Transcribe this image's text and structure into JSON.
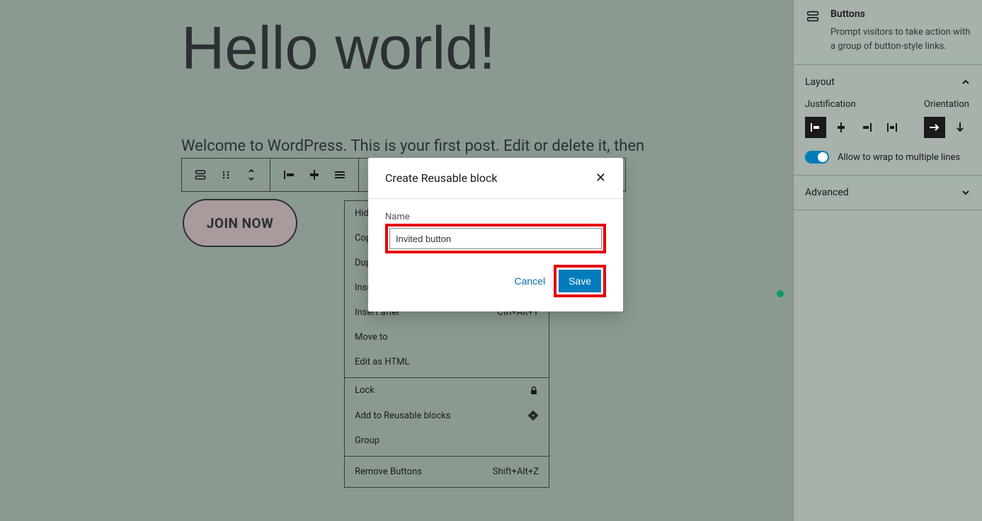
{
  "post": {
    "title": "Hello world!",
    "body": "Welcome to WordPress. This is your first post. Edit or delete it, then",
    "button_label": "JOIN NOW"
  },
  "context_menu": {
    "items": [
      {
        "label": "Hid"
      },
      {
        "label": "Cop"
      },
      {
        "label": "Dup"
      },
      {
        "label": "Inse"
      },
      {
        "label": "Insert after",
        "shortcut": "Ctrl+Alt+Y"
      },
      {
        "label": "Move to"
      },
      {
        "label": "Edit as HTML"
      }
    ],
    "items2": [
      {
        "label": "Lock",
        "icon": "lock"
      },
      {
        "label": "Add to Reusable blocks",
        "icon": "diamond"
      },
      {
        "label": "Group"
      }
    ],
    "items3": [
      {
        "label": "Remove Buttons",
        "shortcut": "Shift+Alt+Z"
      }
    ]
  },
  "modal": {
    "title": "Create Reusable block",
    "name_label": "Name",
    "name_value": "Invited button",
    "cancel": "Cancel",
    "save": "Save"
  },
  "sidebar": {
    "block": {
      "name": "Buttons",
      "description": "Prompt visitors to take action with a group of button-style links."
    },
    "layout": {
      "title": "Layout",
      "justification_label": "Justification",
      "orientation_label": "Orientation",
      "wrap_label": "Allow to wrap to multiple lines"
    },
    "advanced": {
      "title": "Advanced"
    }
  }
}
